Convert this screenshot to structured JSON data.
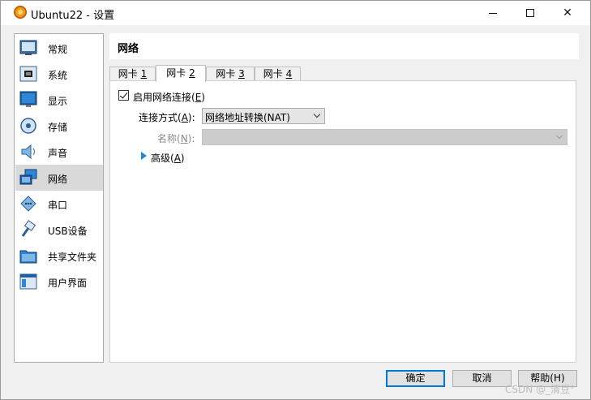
{
  "window": {
    "title": "Ubuntu22 - 设置"
  },
  "nav": {
    "items": [
      {
        "label": "常规",
        "icon": "general-icon"
      },
      {
        "label": "系统",
        "icon": "system-chip-icon"
      },
      {
        "label": "显示",
        "icon": "display-monitor-icon"
      },
      {
        "label": "存储",
        "icon": "storage-disk-icon"
      },
      {
        "label": "声音",
        "icon": "speaker-icon"
      },
      {
        "label": "网络",
        "icon": "network-icon",
        "selected": true
      },
      {
        "label": "串口",
        "icon": "serial-port-icon"
      },
      {
        "label": "USB设备",
        "icon": "usb-icon"
      },
      {
        "label": "共享文件夹",
        "icon": "folder-icon"
      },
      {
        "label": "用户界面",
        "icon": "user-interface-icon"
      }
    ]
  },
  "page": {
    "title": "网络"
  },
  "tabs": [
    {
      "label": "网卡 ",
      "key": "1"
    },
    {
      "label": "网卡 ",
      "key": "2",
      "active": true
    },
    {
      "label": "网卡 ",
      "key": "3"
    },
    {
      "label": "网卡 ",
      "key": "4"
    }
  ],
  "adapter": {
    "enable_label": "启用网络连接(",
    "enable_key": "E",
    "enable_suffix": ")",
    "enabled": true,
    "attach_label": "连接方式(",
    "attach_key": "A",
    "attach_suffix": "):",
    "attach_value": "网络地址转换(NAT)",
    "name_label": "名称(",
    "name_key": "N",
    "name_suffix": "):",
    "name_value": "",
    "advanced_label": "高级(",
    "advanced_key": "A",
    "advanced_suffix": ")"
  },
  "buttons": {
    "ok": "确定",
    "cancel": "取消",
    "help": "帮助(H)"
  },
  "watermark": "CSDN @_清豆°",
  "colors": {
    "accent": "#0078d7",
    "selected_bg": "#d9d9d9",
    "arrow": "#1e88d8"
  }
}
